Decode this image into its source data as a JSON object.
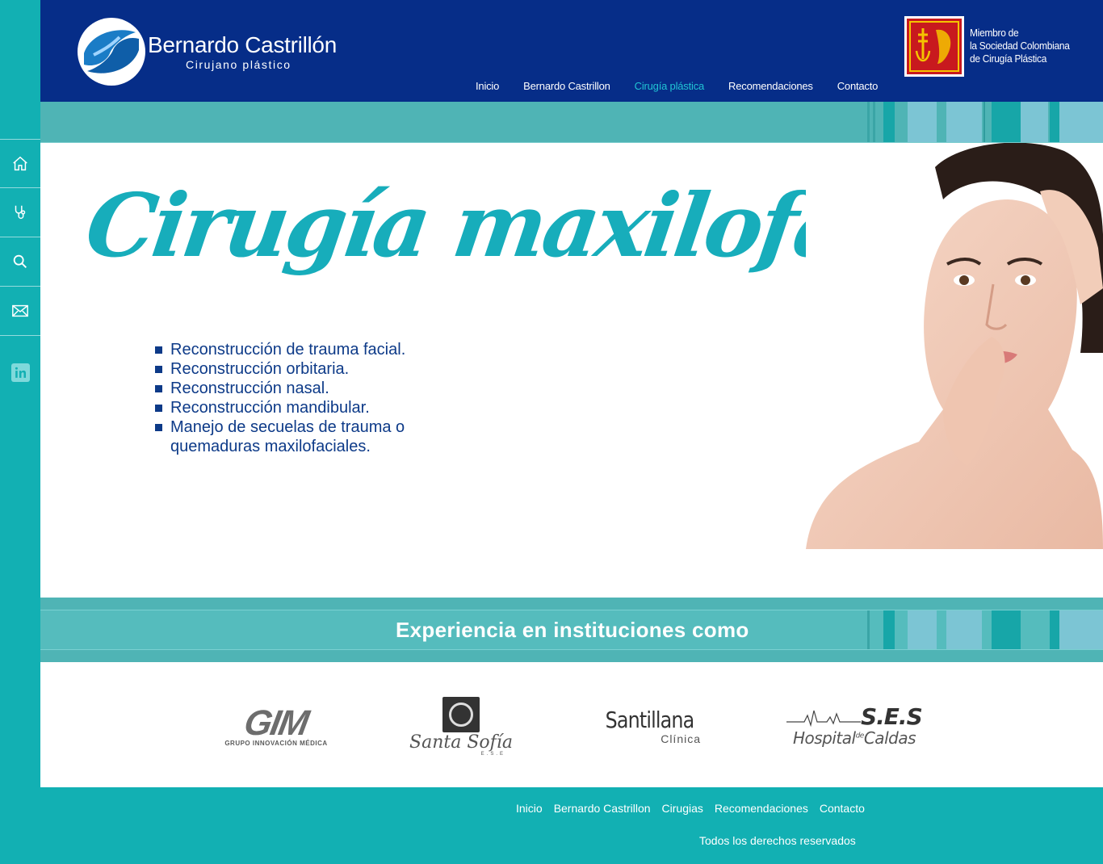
{
  "brand": {
    "name": "Bernardo Castrillón",
    "tagline": "Cirujano plástico"
  },
  "nav": {
    "items": [
      "Inicio",
      "Bernardo Castrillon",
      "Cirugía plástica",
      "Recomendaciones",
      "Contacto"
    ],
    "active": "Cirugía plástica"
  },
  "member": {
    "line1": "Miembro de",
    "line2": "la Sociedad Colombiana",
    "line3": "de Cirugía Plástica"
  },
  "sidebar": {
    "icons": [
      "home-icon",
      "stethoscope-icon",
      "search-icon",
      "mail-icon",
      "linkedin-icon"
    ]
  },
  "main": {
    "title": "Cirugía maxilofacial",
    "bullets": [
      "Reconstrucción de trauma facial.",
      "Reconstrucción orbitaria.",
      "Reconstrucción nasal.",
      "Reconstrucción mandibular.",
      "Manejo de secuelas de trauma o quemaduras maxilofaciales."
    ]
  },
  "experience": {
    "title": "Experiencia en instituciones como"
  },
  "institutions": {
    "gim": {
      "mark": "GIM",
      "sub": "GRUPO INNOVACIÓN MÉDICA"
    },
    "santa_sofia": {
      "name": "Santa Sofía",
      "sub": "E.S.E"
    },
    "santillana": {
      "name": "Santillana",
      "sub": "Clínica"
    },
    "hospital_caldas": {
      "mark": "S.E.S",
      "name1": "Hospital",
      "de": "de",
      "name2": "Caldas"
    }
  },
  "footer": {
    "items": [
      "Inicio",
      "Bernardo Castrillon",
      "Cirugias",
      "Recomendaciones",
      "Contacto"
    ],
    "copyright": "Todos los derechos reservados"
  },
  "colors": {
    "header_bg": "#062d88",
    "accent": "#12b0b3",
    "nav_active": "#21c4d4",
    "title": "#17adbb",
    "bullet_text": "#0d3a88"
  }
}
